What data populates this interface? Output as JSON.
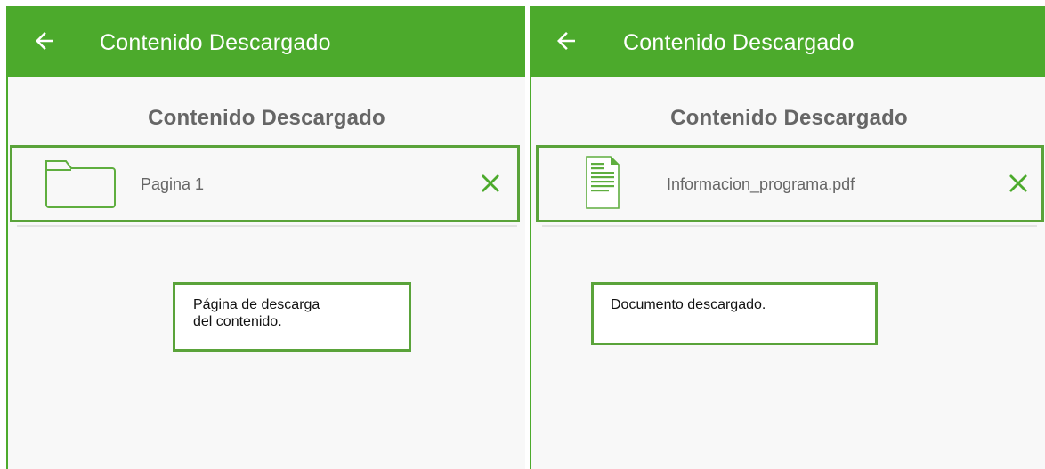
{
  "screens": [
    {
      "appbar": {
        "title": "Contenido Descargado",
        "back_icon": "arrow-back-icon"
      },
      "page_title": "Contenido Descargado",
      "item": {
        "label": "Pagina 1",
        "icon": "folder-icon",
        "remove_icon": "close-icon"
      },
      "note": {
        "lines": [
          "Página de descarga",
          "del contenido."
        ]
      }
    },
    {
      "appbar": {
        "title": "Contenido Descargado",
        "back_icon": "arrow-back-icon"
      },
      "page_title": "Contenido Descargado",
      "item": {
        "label": "Informacion_programa.pdf",
        "icon": "document-icon",
        "remove_icon": "close-icon"
      },
      "note": {
        "lines": [
          "Documento descargado."
        ]
      }
    }
  ],
  "colors": {
    "primary": "#4caa2c",
    "highlight_border": "#5aa33a",
    "background": "#f8f8f8",
    "text_secondary": "#666666"
  }
}
